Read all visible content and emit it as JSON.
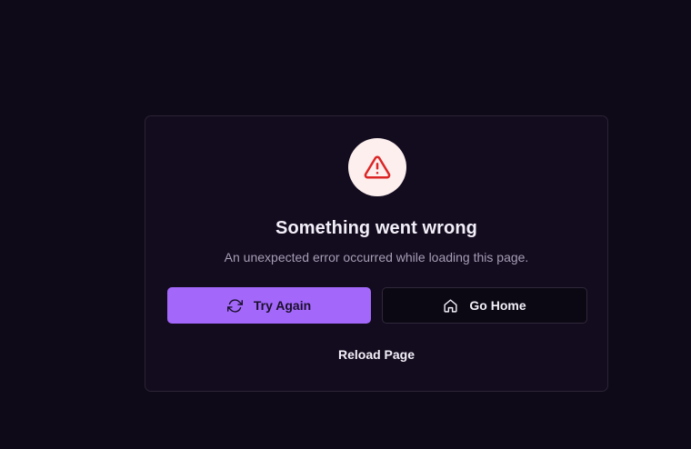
{
  "error_card": {
    "icon": "warning-triangle-icon",
    "title": "Something went wrong",
    "message": "An unexpected error occurred while loading this page.",
    "try_again_label": "Try Again",
    "try_again_icon": "refresh-icon",
    "go_home_label": "Go Home",
    "go_home_icon": "home-icon",
    "reload_label": "Reload Page"
  },
  "colors": {
    "background": "#0f0a18",
    "card": "#130c1f",
    "primary": "#a368fa",
    "danger": "#dc2626",
    "danger_bg": "#fcefee"
  }
}
